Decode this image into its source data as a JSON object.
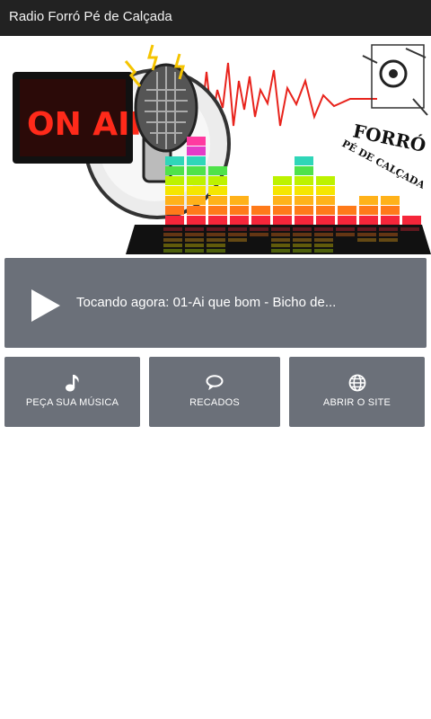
{
  "app": {
    "title": "Radio Forró Pé de Calçada"
  },
  "banner": {
    "onair_text": "ON AIR",
    "logo_text_1": "FORRÓ",
    "logo_text_2": "PÉ DE CALÇADA"
  },
  "player": {
    "now_playing": "Tocando agora: 01-Ai que bom - Bicho de...",
    "play_icon": "play-icon"
  },
  "actions": [
    {
      "label": "PEÇA SUA MÚSICA",
      "icon": "music-note-icon"
    },
    {
      "label": "RECADOS",
      "icon": "chat-bubble-icon"
    },
    {
      "label": "ABRIR O SITE",
      "icon": "globe-icon"
    }
  ],
  "colors": {
    "appbar": "#222222",
    "tile": "#6b7079",
    "onair": "#ff2a1a"
  }
}
